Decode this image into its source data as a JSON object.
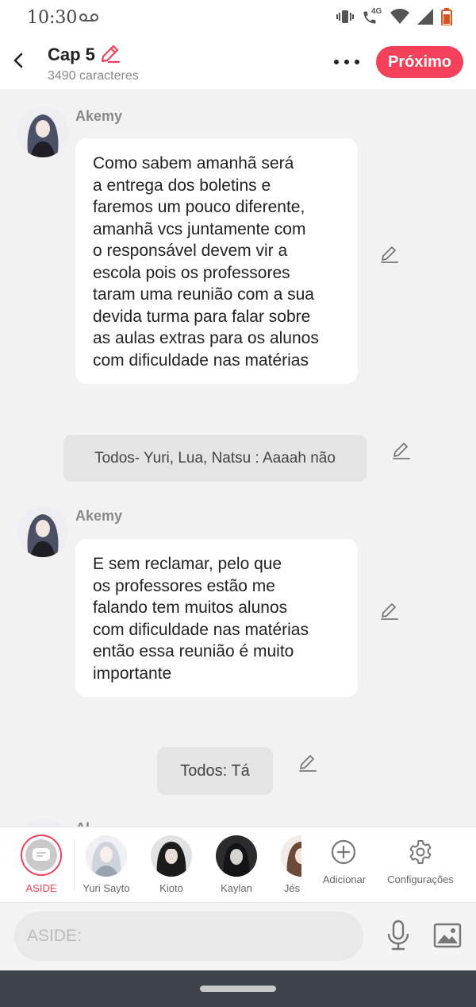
{
  "status_bar": {
    "time": "10:30",
    "network_label": "4G"
  },
  "header": {
    "title": "Cap 5",
    "char_count": "3490 caracteres",
    "next_label": "Próximo",
    "accent": "#f5405a"
  },
  "messages": [
    {
      "type": "character",
      "speaker": "Akemy",
      "text": "Como sabem amanhã será\na entrega dos boletins e\nfaremos um pouco diferente,\namanhã vcs juntamente com\no responsável devem vir a\nescola pois os professores\ntaram uma reunião com a sua\ndevida turma para falar sobre\nas aulas extras para os alunos\ncom dificuldade nas matérias"
    },
    {
      "type": "group",
      "text": "Todos- Yuri, Lua, Natsu : Aaaah não"
    },
    {
      "type": "character",
      "speaker": "Akemy",
      "text": "E sem reclamar, pelo que\nos professores estão me\nfalando tem muitos alunos\ncom dificuldade nas matérias\nentão essa reunião é muito\nimportante"
    },
    {
      "type": "group",
      "text": "Todos: Tá"
    },
    {
      "type": "character",
      "speaker": "Al"
    }
  ],
  "characters": [
    {
      "name": "ASIDE",
      "selected": true,
      "icon": "aside-chat-icon"
    },
    {
      "name": "Yuri Sayto",
      "icon": "avatar-yuri"
    },
    {
      "name": "Kioto",
      "icon": "avatar-kioto"
    },
    {
      "name": "Kaylan",
      "icon": "avatar-kaylan"
    },
    {
      "name": "Jés",
      "icon": "avatar-jes"
    }
  ],
  "tools": {
    "add_label": "Adicionar",
    "settings_label": "Configurações"
  },
  "input": {
    "placeholder": "ASIDE:"
  }
}
